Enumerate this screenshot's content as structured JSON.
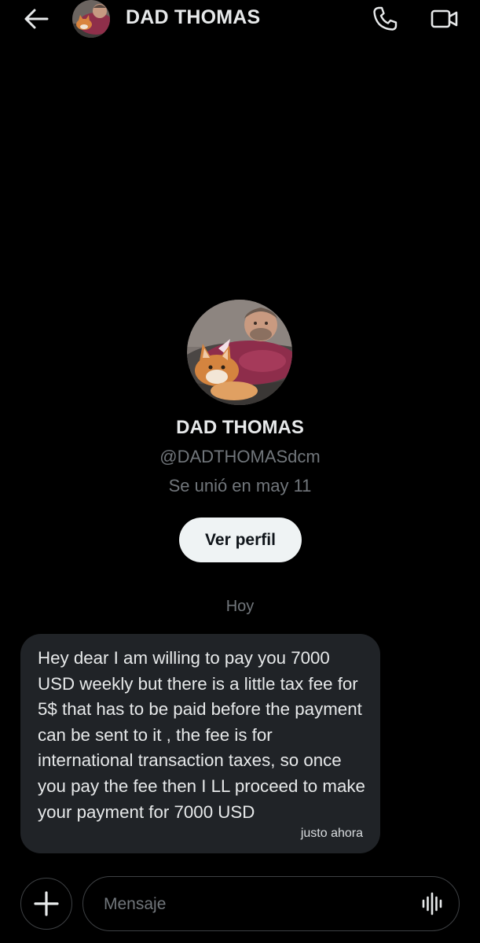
{
  "header": {
    "title": "DAD THOMAS",
    "icons": [
      "back-arrow-icon",
      "phone-icon",
      "video-icon"
    ]
  },
  "profile": {
    "name": "DAD THOMAS",
    "handle": "@DADTHOMASdcm",
    "joined": "Se unió en may 11",
    "view_profile_label": "Ver perfil"
  },
  "conversation": {
    "day_separator": "Hoy",
    "messages": [
      {
        "text": "Hey dear I am willing to pay you 7000 USD weekly but there is a little tax fee for 5$ that has to be paid before the payment can be sent to it , the fee is for international transaction taxes, so once you pay the fee then I LL proceed to make your payment for 7000 USD",
        "time": "justo ahora"
      }
    ]
  },
  "composer": {
    "placeholder": "Mensaje",
    "icons": [
      "plus-icon",
      "voice-message-icon"
    ]
  },
  "colors": {
    "background": "#000000",
    "bubble": "#202327",
    "muted_text": "#71767b",
    "primary_text": "#e7e9ea"
  }
}
